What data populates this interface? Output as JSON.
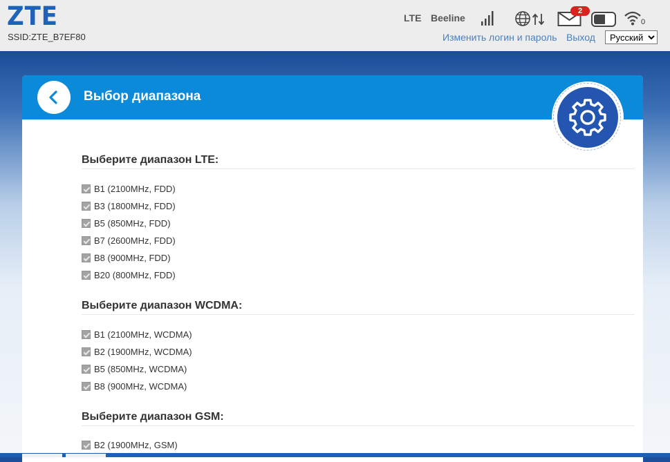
{
  "header": {
    "logo": "ZTE",
    "ssid": "SSID:ZTE_B7EF80",
    "network_type": "LTE",
    "operator": "Beeline",
    "icons": [
      "signal-bars-icon",
      "globe-arrows-icon",
      "mail-icon",
      "battery-icon",
      "wifi-icon"
    ],
    "unread_messages": "2",
    "wifi_clients": "0",
    "change_login_link": "Изменить логин и пароль",
    "logout_link": "Выход",
    "language": "Русский"
  },
  "panel": {
    "title": "Выбор диапазона",
    "back_icon": "chevron-left-icon",
    "gear_icon": "gear-icon",
    "lte": {
      "title": "Выберите диапазон LTE:",
      "bands": [
        "B1 (2100MHz, FDD)",
        "B3 (1800MHz, FDD)",
        "B5 (850MHz, FDD)",
        "B7 (2600MHz, FDD)",
        "B8 (900MHz, FDD)",
        "B20 (800MHz, FDD)"
      ]
    },
    "wcdma": {
      "title": "Выберите диапазон WCDMA:",
      "bands": [
        "B1 (2100MHz, WCDMA)",
        "B2 (1900MHz, WCDMA)",
        "B5 (850MHz, WCDMA)",
        "B8 (900MHz, WCDMA)"
      ]
    },
    "gsm": {
      "title": "Выберите диапазон GSM:",
      "bands": [
        "B2 (1900MHz, GSM)"
      ]
    }
  },
  "colors": {
    "brand": "#1e63b8",
    "panel_header": "#0a8ad8",
    "gear_badge": "#2455b0",
    "link": "#4a7fbf",
    "badge": "#d9231f"
  }
}
